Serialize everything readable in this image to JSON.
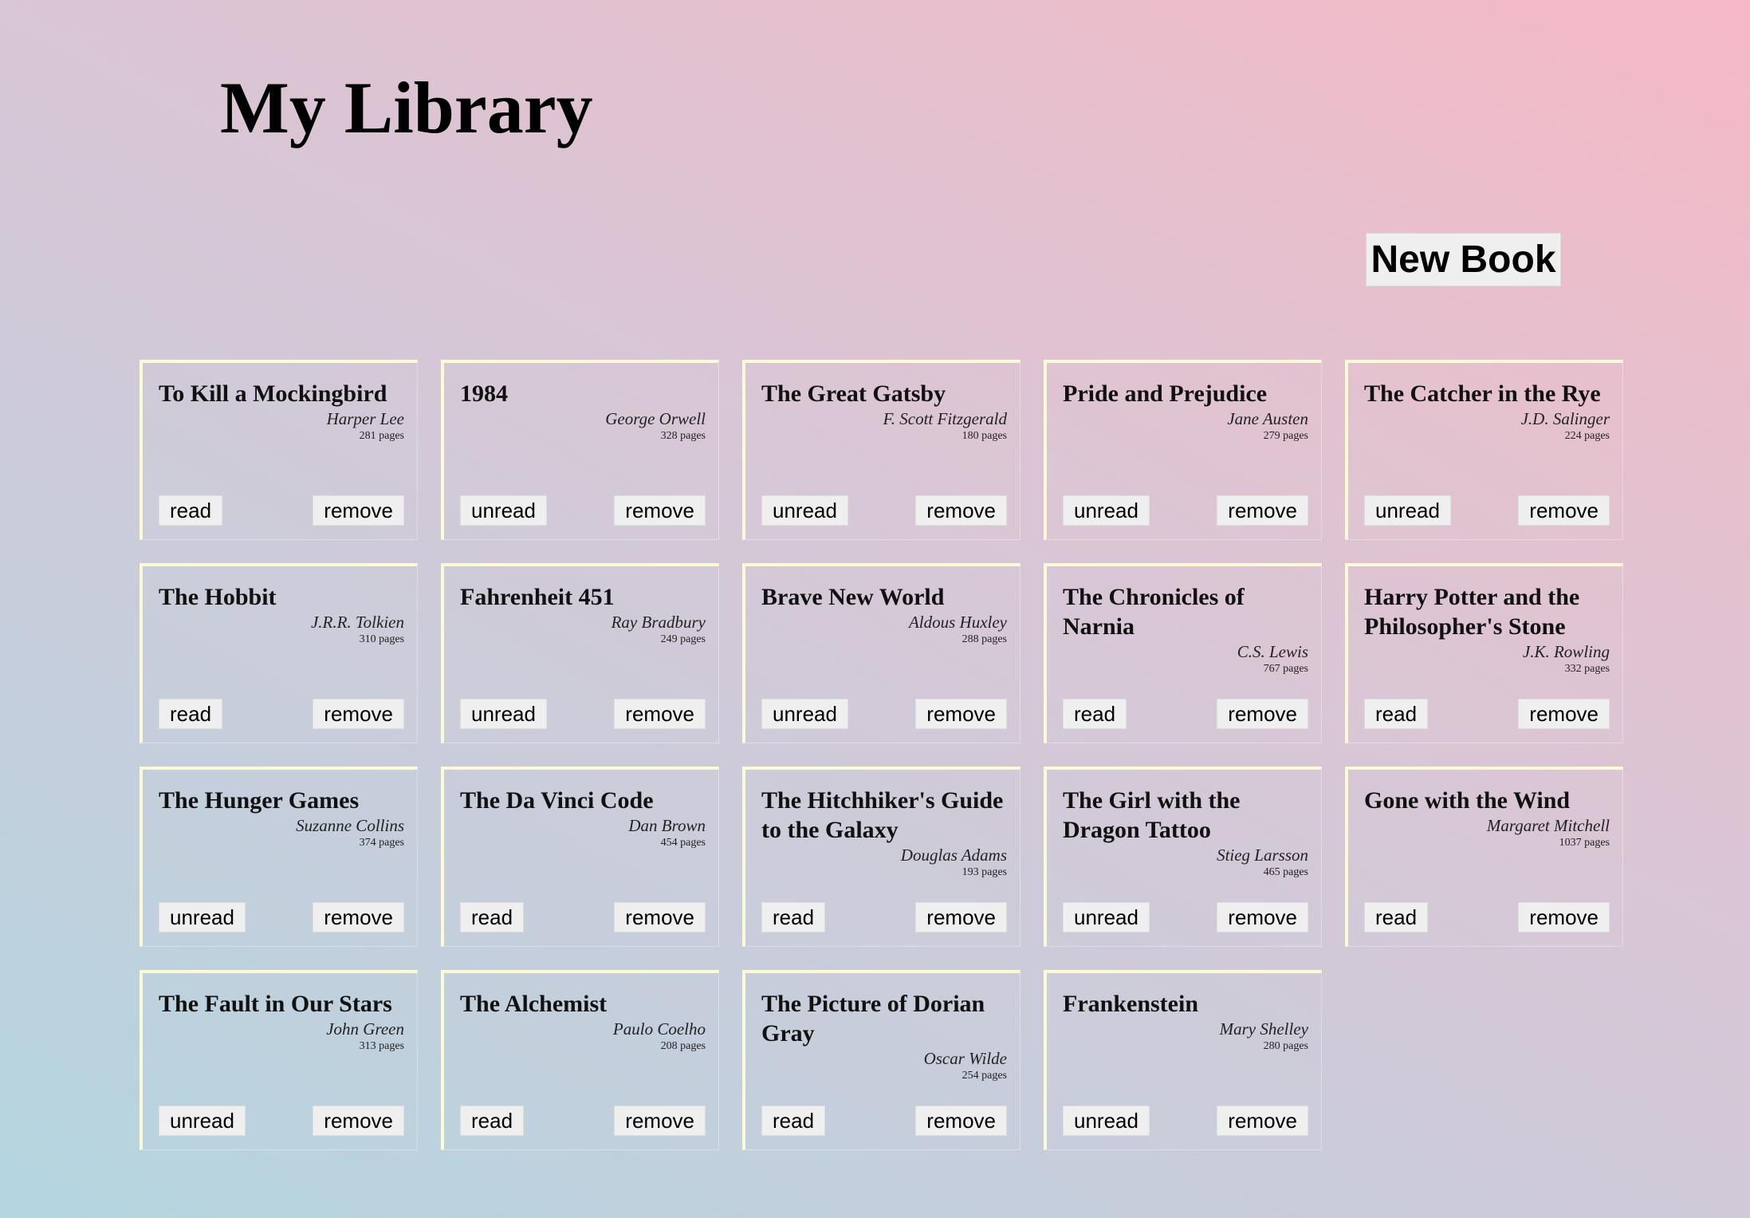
{
  "header": {
    "title": "My Library",
    "new_book_label": "New Book"
  },
  "actions": {
    "remove_label": "remove"
  },
  "books": [
    {
      "title": "To Kill a Mockingbird",
      "author": "Harper Lee",
      "pages": "281 pages",
      "toggle_label": "read"
    },
    {
      "title": "1984",
      "author": "George Orwell",
      "pages": "328 pages",
      "toggle_label": "unread"
    },
    {
      "title": "The Great Gatsby",
      "author": "F. Scott Fitzgerald",
      "pages": "180 pages",
      "toggle_label": "unread"
    },
    {
      "title": "Pride and Prejudice",
      "author": "Jane Austen",
      "pages": "279 pages",
      "toggle_label": "unread"
    },
    {
      "title": "The Catcher in the Rye",
      "author": "J.D. Salinger",
      "pages": "224 pages",
      "toggle_label": "unread"
    },
    {
      "title": "The Hobbit",
      "author": "J.R.R. Tolkien",
      "pages": "310 pages",
      "toggle_label": "read"
    },
    {
      "title": "Fahrenheit 451",
      "author": "Ray Bradbury",
      "pages": "249 pages",
      "toggle_label": "unread"
    },
    {
      "title": "Brave New World",
      "author": "Aldous Huxley",
      "pages": "288 pages",
      "toggle_label": "unread"
    },
    {
      "title": "The Chronicles of Narnia",
      "author": "C.S. Lewis",
      "pages": "767 pages",
      "toggle_label": "read"
    },
    {
      "title": "Harry Potter and the Philosopher's Stone",
      "author": "J.K. Rowling",
      "pages": "332 pages",
      "toggle_label": "read"
    },
    {
      "title": "The Hunger Games",
      "author": "Suzanne Collins",
      "pages": "374 pages",
      "toggle_label": "unread"
    },
    {
      "title": "The Da Vinci Code",
      "author": "Dan Brown",
      "pages": "454 pages",
      "toggle_label": "read"
    },
    {
      "title": "The Hitchhiker's Guide to the Galaxy",
      "author": "Douglas Adams",
      "pages": "193 pages",
      "toggle_label": "read"
    },
    {
      "title": "The Girl with the Dragon Tattoo",
      "author": "Stieg Larsson",
      "pages": "465 pages",
      "toggle_label": "unread"
    },
    {
      "title": "Gone with the Wind",
      "author": "Margaret Mitchell",
      "pages": "1037 pages",
      "toggle_label": "read"
    },
    {
      "title": "The Fault in Our Stars",
      "author": "John Green",
      "pages": "313 pages",
      "toggle_label": "unread"
    },
    {
      "title": "The Alchemist",
      "author": "Paulo Coelho",
      "pages": "208 pages",
      "toggle_label": "read"
    },
    {
      "title": "The Picture of Dorian Gray",
      "author": "Oscar Wilde",
      "pages": "254 pages",
      "toggle_label": "read"
    },
    {
      "title": "Frankenstein",
      "author": "Mary Shelley",
      "pages": "280 pages",
      "toggle_label": "unread"
    }
  ]
}
